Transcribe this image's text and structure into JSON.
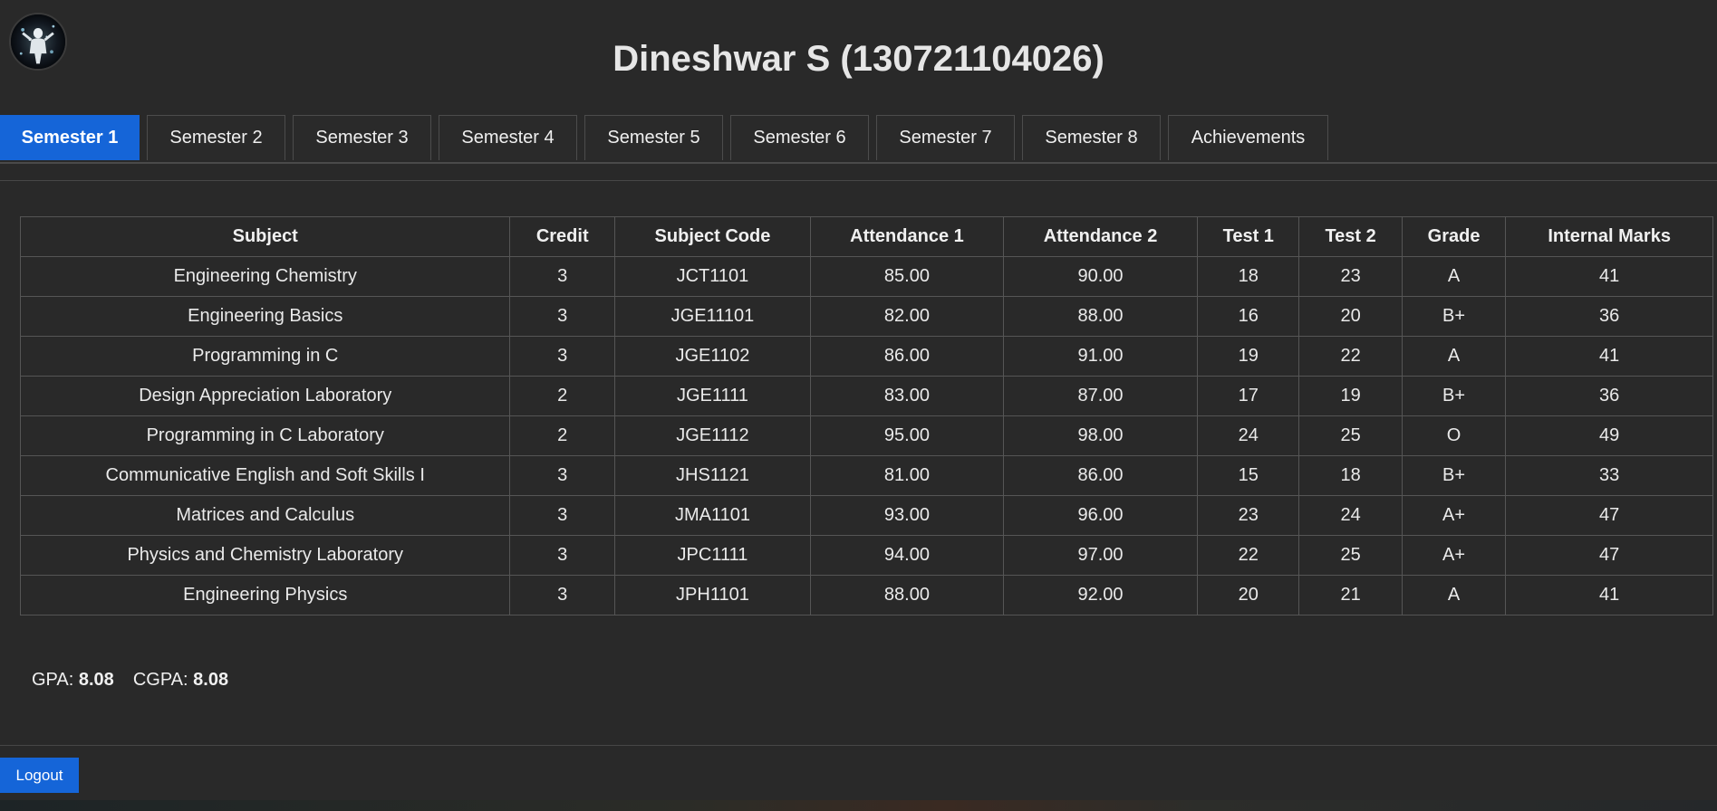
{
  "header": {
    "title": "Dineshwar S (130721104026)",
    "avatar_icon": "profile-photo-icon"
  },
  "tabs": [
    {
      "label": "Semester 1",
      "active": true
    },
    {
      "label": "Semester 2",
      "active": false
    },
    {
      "label": "Semester 3",
      "active": false
    },
    {
      "label": "Semester 4",
      "active": false
    },
    {
      "label": "Semester 5",
      "active": false
    },
    {
      "label": "Semester 6",
      "active": false
    },
    {
      "label": "Semester 7",
      "active": false
    },
    {
      "label": "Semester 8",
      "active": false
    },
    {
      "label": "Achievements",
      "active": false
    }
  ],
  "table": {
    "columns": [
      "Subject",
      "Credit",
      "Subject Code",
      "Attendance 1",
      "Attendance 2",
      "Test 1",
      "Test 2",
      "Grade",
      "Internal Marks"
    ],
    "rows": [
      [
        "Engineering Chemistry",
        "3",
        "JCT1101",
        "85.00",
        "90.00",
        "18",
        "23",
        "A",
        "41"
      ],
      [
        "Engineering Basics",
        "3",
        "JGE11101",
        "82.00",
        "88.00",
        "16",
        "20",
        "B+",
        "36"
      ],
      [
        "Programming in C",
        "3",
        "JGE1102",
        "86.00",
        "91.00",
        "19",
        "22",
        "A",
        "41"
      ],
      [
        "Design Appreciation Laboratory",
        "2",
        "JGE1111",
        "83.00",
        "87.00",
        "17",
        "19",
        "B+",
        "36"
      ],
      [
        "Programming in C Laboratory",
        "2",
        "JGE1112",
        "95.00",
        "98.00",
        "24",
        "25",
        "O",
        "49"
      ],
      [
        "Communicative English and Soft Skills I",
        "3",
        "JHS1121",
        "81.00",
        "86.00",
        "15",
        "18",
        "B+",
        "33"
      ],
      [
        "Matrices and Calculus",
        "3",
        "JMA1101",
        "93.00",
        "96.00",
        "23",
        "24",
        "A+",
        "47"
      ],
      [
        "Physics and Chemistry Laboratory",
        "3",
        "JPC1111",
        "94.00",
        "97.00",
        "22",
        "25",
        "A+",
        "47"
      ],
      [
        "Engineering Physics",
        "3",
        "JPH1101",
        "88.00",
        "92.00",
        "20",
        "21",
        "A",
        "41"
      ]
    ]
  },
  "summary": {
    "gpa_label": "GPA:",
    "gpa_value": "8.08",
    "cgpa_label": "CGPA:",
    "cgpa_value": "8.08"
  },
  "footer": {
    "logout_label": "Logout"
  },
  "colors": {
    "background": "#292929",
    "accent": "#1565d8",
    "text": "#e8e8e8"
  }
}
